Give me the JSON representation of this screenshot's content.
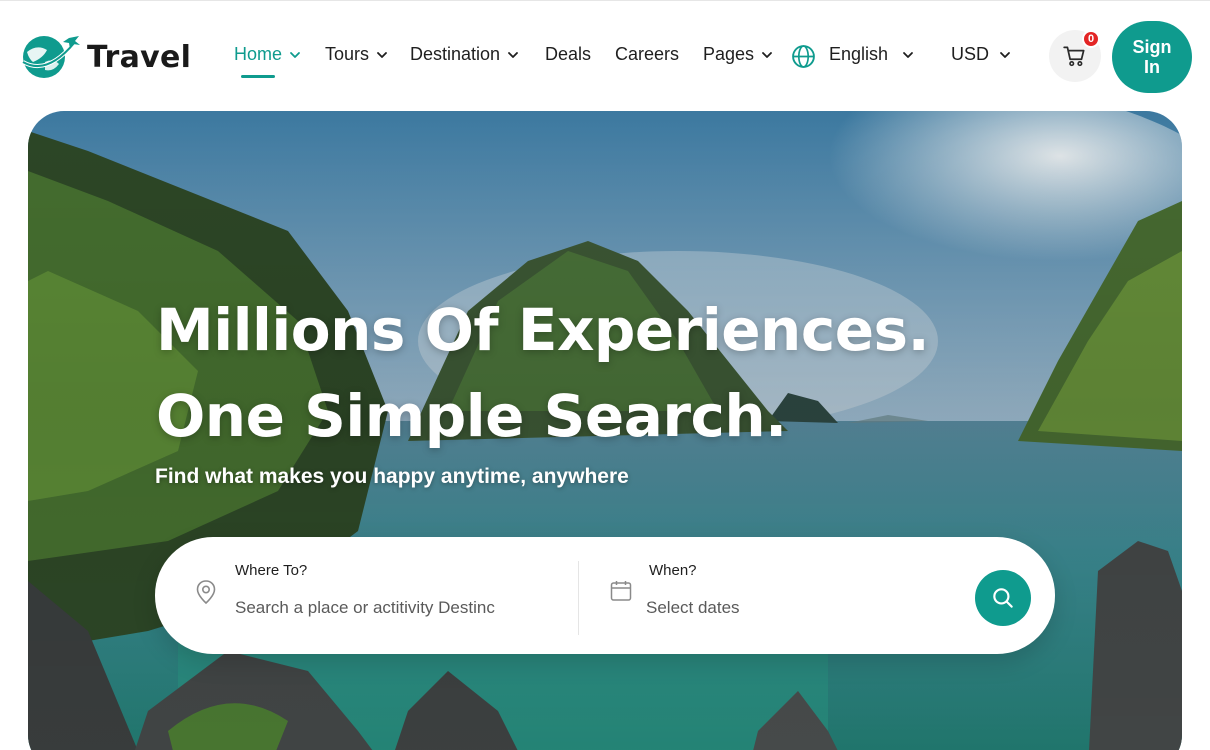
{
  "brand": {
    "name": "Travel",
    "accent": "#0f9b8e"
  },
  "nav": {
    "items": [
      {
        "label": "Home",
        "dropdown": true,
        "active": true
      },
      {
        "label": "Tours",
        "dropdown": true
      },
      {
        "label": "Destination",
        "dropdown": true
      },
      {
        "label": "Deals",
        "dropdown": false
      },
      {
        "label": "Careers",
        "dropdown": false
      },
      {
        "label": "Pages",
        "dropdown": true
      }
    ],
    "language": "English",
    "currency": "USD",
    "cart_count": "0",
    "signin_label": "Sign In",
    "icons": [
      "chevron-down-icon",
      "globe-icon",
      "cart-icon"
    ]
  },
  "hero": {
    "title_line1": "Millions Of Experiences.",
    "title_line2": "One Simple Search.",
    "subtitle": "Find what makes you happy anytime, anywhere"
  },
  "search": {
    "where_label": "Where To?",
    "where_placeholder": "Search a place or actitivity Destinc",
    "when_label": "When?",
    "when_placeholder": "Select dates",
    "icons": [
      "map-pin-icon",
      "calendar-icon",
      "search-icon"
    ]
  }
}
